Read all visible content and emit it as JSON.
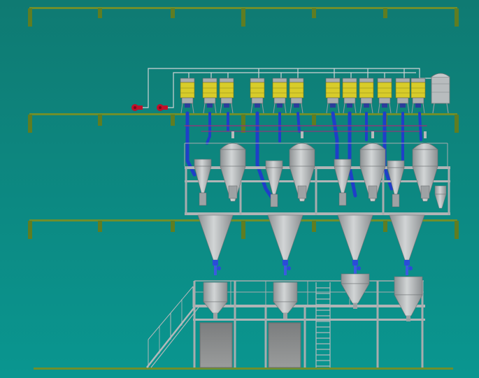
{
  "colors": {
    "background_top": "#0f7a72",
    "background_bottom": "#0a9690",
    "floor_beam": "#6f8f2c",
    "floor_post": "#5f7d22",
    "steel_frame": "#a8acae",
    "duct_blue": "#1f3fc8",
    "duct_purple": "#8a3a7a",
    "bin_yellow": "#d8cc2a",
    "bin_grey": "#a9adb0",
    "dust_collector": "#b8bcbe",
    "fan_red": "#c0102a",
    "cyclone_steel": "#b6b9bb",
    "hopper_mesh": "#8c8c8c",
    "pipe_rail": "#cfd3d5",
    "valve_blue": "#2a4cd8"
  },
  "icons": {
    "feeder_bin": "feeder-bin-icon",
    "fan": "blower-fan-icon",
    "cyclone": "cyclone-separator-icon",
    "mixer": "mixer-tank-icon",
    "hopper": "hopper-icon",
    "ladder": "ladder-icon",
    "stair": "staircase-icon",
    "dust_collector": "dust-collector-icon"
  }
}
